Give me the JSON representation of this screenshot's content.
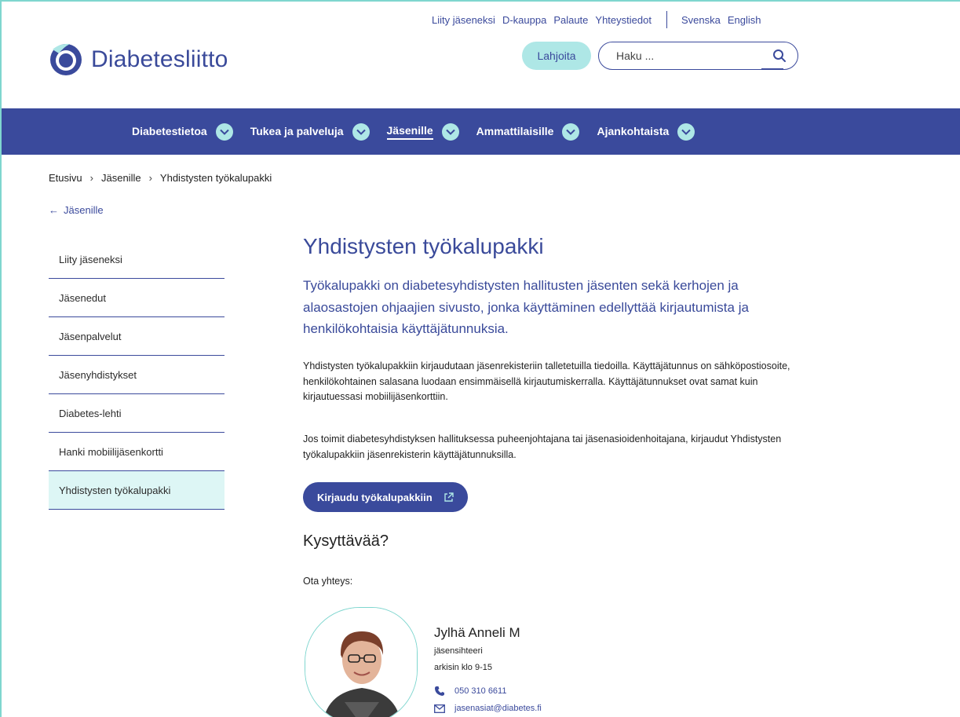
{
  "utility_nav": {
    "links": [
      "Liity jäseneksi",
      "D-kauppa",
      "Palaute",
      "Yhteystiedot"
    ],
    "languages": [
      "Svenska",
      "English"
    ]
  },
  "brand": {
    "name": "Diabetesliitto"
  },
  "header": {
    "donate_label": "Lahjoita",
    "search_placeholder": "Haku ..."
  },
  "main_nav": {
    "items": [
      {
        "label": "Diabetestietoa"
      },
      {
        "label": "Tukea ja palveluja"
      },
      {
        "label": "Jäsenille",
        "active": true
      },
      {
        "label": "Ammattilaisille"
      },
      {
        "label": "Ajankohtaista"
      }
    ]
  },
  "breadcrumb": {
    "items": [
      "Etusivu",
      "Jäsenille",
      "Yhdistysten työkalupakki"
    ]
  },
  "back_link": "Jäsenille",
  "sidebar": {
    "items": [
      {
        "label": "Liity jäseneksi"
      },
      {
        "label": "Jäsenedut"
      },
      {
        "label": "Jäsenpalvelut"
      },
      {
        "label": "Jäsenyhdistykset"
      },
      {
        "label": "Diabetes-lehti"
      },
      {
        "label": "Hanki mobiilijäsenkortti"
      },
      {
        "label": "Yhdistysten työkalupakki",
        "active": true
      }
    ]
  },
  "content": {
    "title": "Yhdistysten työkalupakki",
    "lead": "Työkalupakki on diabetesyhdistysten hallitusten jäsenten sekä kerhojen ja alaosastojen ohjaajien sivusto, jonka käyttäminen edellyttää kirjautumista ja henkilökohtaisia käyttäjätunnuksia.",
    "paragraph1": "Yhdistysten työkalupakkiin kirjaudutaan jäsenrekisteriin talletetuilla tiedoilla. Käyttäjätunnus on sähköpostiosoite, henkilökohtainen salasana luodaan ensimmäisellä kirjautumiskerralla. Käyttäjätunnukset ovat samat kuin kirjautuessasi mobiilijäsenkorttiin.",
    "paragraph2": "Jos toimit diabetesyhdistyksen hallituksessa puheenjohtajana tai jäsenasioidenhoitajana, kirjaudut Yhdistysten työkalupakkiin jäsenrekisterin käyttäjätunnuksilla.",
    "cta_label": "Kirjaudu työkalupakkiin",
    "questions_heading": "Kysyttävää?",
    "contact_intro": "Ota yhteys:"
  },
  "contact": {
    "name": "Jylhä Anneli M",
    "title": "jäsensihteeri",
    "hours": "arkisin klo 9-15",
    "phone": "050 310 6611",
    "email": "jasenasiat@diabetes.fi"
  },
  "colors": {
    "brand_blue": "#3a4a9c",
    "accent_mint": "#aee7e6",
    "active_bg": "#ddf6f5"
  }
}
